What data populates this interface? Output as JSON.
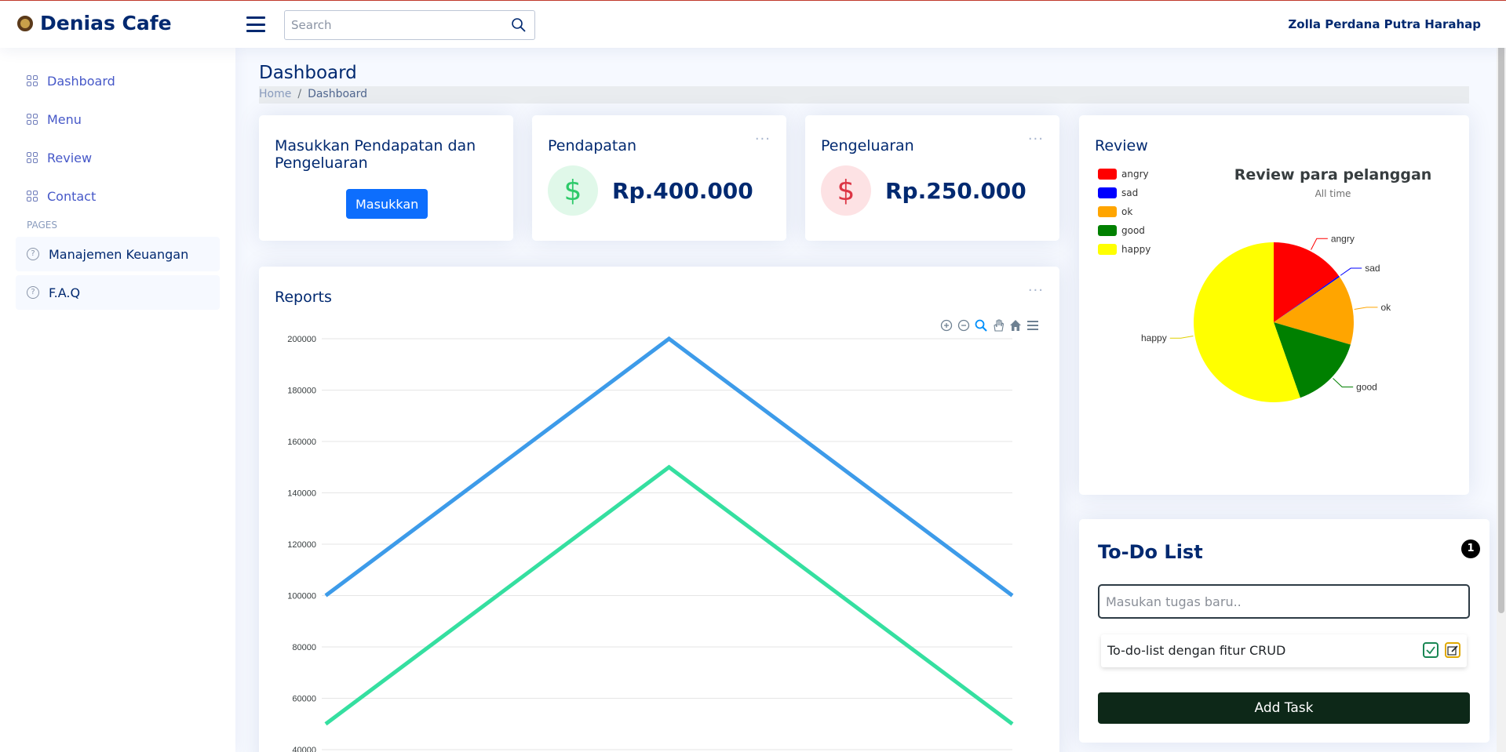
{
  "header": {
    "brand": "Denias Cafe",
    "search_placeholder": "Search",
    "user_name": "Zolla Perdana Putra Harahap"
  },
  "sidebar": {
    "items": [
      {
        "label": "Dashboard",
        "icon": "grid-icon"
      },
      {
        "label": "Menu",
        "icon": "grid-icon"
      },
      {
        "label": "Review",
        "icon": "grid-icon"
      },
      {
        "label": "Contact",
        "icon": "grid-icon"
      }
    ],
    "pages_heading": "PAGES",
    "pages": [
      {
        "label": "Manajemen Keuangan",
        "icon": "question-circle-icon"
      },
      {
        "label": "F.A.Q",
        "icon": "question-circle-icon"
      }
    ]
  },
  "page": {
    "title": "Dashboard",
    "breadcrumb": [
      "Home",
      "Dashboard"
    ]
  },
  "input_card": {
    "title": "Masukkan Pendapatan dan Pengeluaran",
    "button": "Masukkan"
  },
  "income_card": {
    "title": "Pendapatan",
    "currency_symbol": "$",
    "amount": "Rp.400.000",
    "color": "#2eca6a"
  },
  "expense_card": {
    "title": "Pengeluaran",
    "currency_symbol": "$",
    "amount": "Rp.250.000",
    "color": "#dc3545"
  },
  "reports": {
    "title": "Reports"
  },
  "review": {
    "card_title": "Review"
  },
  "todo": {
    "title": "To-Do List",
    "count": "1",
    "input_placeholder": "Masukan tugas baru..",
    "items": [
      "To-do-list dengan fitur CRUD"
    ],
    "add_button": "Add Task"
  },
  "chart_data": [
    {
      "type": "line",
      "x": [
        0,
        1,
        2
      ],
      "series": [
        {
          "values": [
            100000,
            200000,
            100000
          ],
          "color": "#3d9be9"
        },
        {
          "values": [
            50000,
            150000,
            50000
          ],
          "color": "#35dfa0"
        }
      ],
      "ylim": [
        40000,
        200000
      ],
      "yticks": [
        40000,
        60000,
        80000,
        100000,
        120000,
        140000,
        160000,
        180000,
        200000
      ],
      "grid": true
    },
    {
      "type": "pie",
      "title": "Review para pelanggan",
      "subtitle": "All time",
      "categories": [
        "angry",
        "sad",
        "ok",
        "good",
        "happy"
      ],
      "values": [
        15,
        0.3,
        14,
        15,
        55
      ],
      "colors": [
        "#ff0000",
        "#0000ff",
        "#ffa500",
        "#008000",
        "#ffff00"
      ],
      "legend": "top-left"
    }
  ]
}
